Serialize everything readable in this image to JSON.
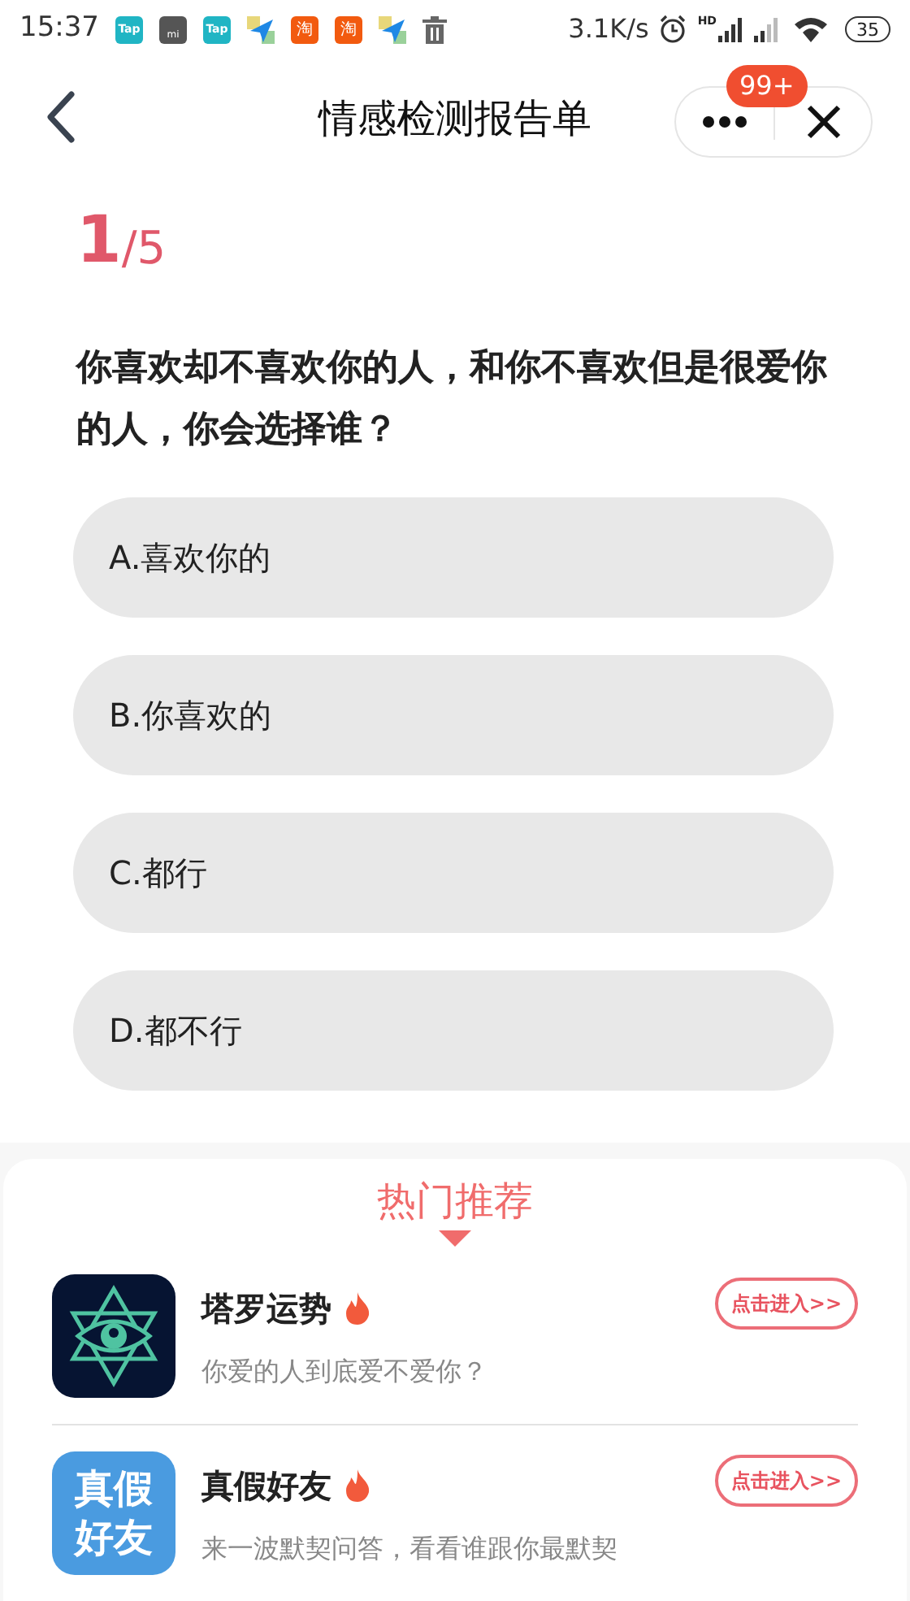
{
  "status_bar": {
    "time": "15:37",
    "notifications": [
      {
        "kind": "tap",
        "label": "Tap"
      },
      {
        "kind": "mi",
        "label": "mi"
      },
      {
        "kind": "tap",
        "label": "Tap"
      },
      {
        "kind": "plane"
      },
      {
        "kind": "taobao",
        "label": "淘"
      },
      {
        "kind": "taobao",
        "label": "淘"
      },
      {
        "kind": "plane"
      },
      {
        "kind": "trash"
      }
    ],
    "speed": "3.1K/s",
    "hd": "HD",
    "battery": "35"
  },
  "header": {
    "title": "情感检测报告单",
    "badge": "99+"
  },
  "progress": {
    "current": "1",
    "total": "/5"
  },
  "question": "你喜欢却不喜欢你的人，和你不喜欢但是很爱你的人，你会选择谁？",
  "options": [
    {
      "label": "A.喜欢你的",
      "selected": false
    },
    {
      "label": "B.你喜欢的",
      "selected": false
    },
    {
      "label": "C.都行",
      "selected": false
    },
    {
      "label": "D.都不行",
      "selected": false
    }
  ],
  "recommend": {
    "title": "热门推荐",
    "items": [
      {
        "kind": "tarot",
        "name": "塔罗运势",
        "desc": "你爱的人到底爱不爱你？",
        "button": "点击进入>>"
      },
      {
        "kind": "friends",
        "name": "真假好友",
        "icon_text": [
          "真假",
          "好友"
        ],
        "desc": "来一波默契问答，看看谁跟你最默契",
        "button": "点击进入>>"
      }
    ]
  }
}
